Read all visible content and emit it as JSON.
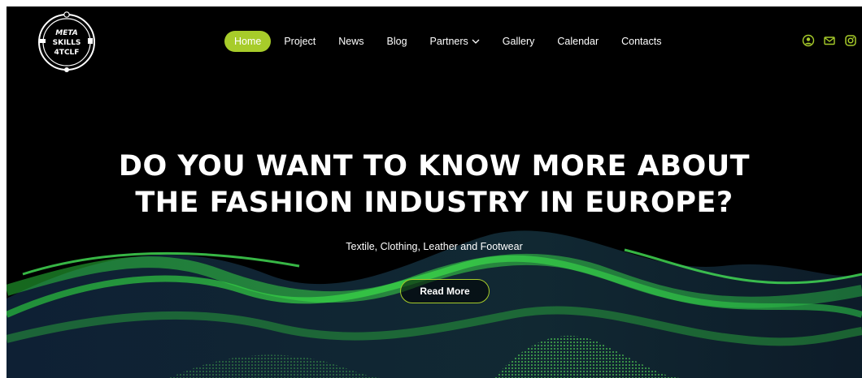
{
  "header": {
    "logo_text": [
      "META",
      "SKILLS",
      "4TCLF"
    ],
    "nav": [
      {
        "label": "Home",
        "active": true
      },
      {
        "label": "Project"
      },
      {
        "label": "News"
      },
      {
        "label": "Blog"
      },
      {
        "label": "Partners",
        "has_dropdown": true
      },
      {
        "label": "Gallery"
      },
      {
        "label": "Calendar"
      },
      {
        "label": "Contacts"
      }
    ],
    "social_icons": [
      "user-circle-icon",
      "mail-icon",
      "instagram-icon"
    ]
  },
  "hero": {
    "title_line1": "DO YOU WANT TO KNOW MORE ABOUT",
    "title_line2": "THE FASHION INDUSTRY IN EUROPE?",
    "subtitle": "Textile, Clothing, Leather and Footwear",
    "cta_label": "Read More"
  },
  "colors": {
    "accent": "#a7cc2a",
    "background": "#000000",
    "text": "#ffffff",
    "wave_green": "#3ecf3a",
    "wave_dark": "#1c3a5a"
  }
}
